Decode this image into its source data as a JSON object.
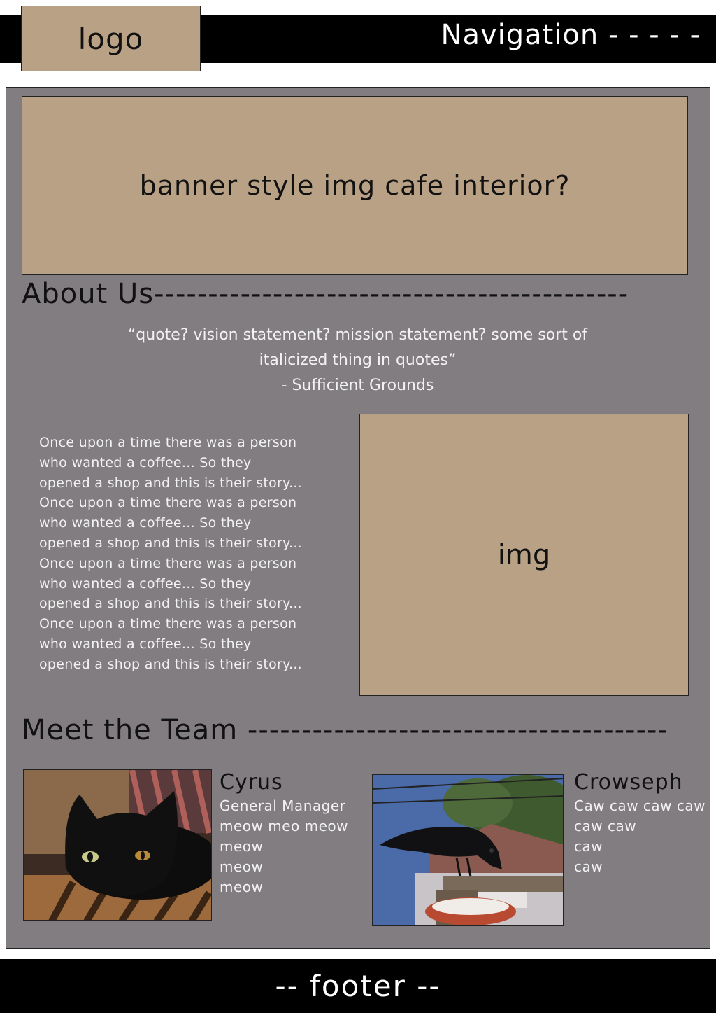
{
  "header": {
    "logo_label": "logo",
    "nav_label": "Navigation - - - - -"
  },
  "banner": {
    "label": "banner style img cafe interior?"
  },
  "about": {
    "title": "About Us--------------------------------------------",
    "quote_line1": "“quote? vision statement? mission statement? some sort of",
    "quote_line2": "italicized thing in quotes”",
    "quote_attribution": "- Sufficient Grounds",
    "story_lines": [
      "Once upon a time there was a person",
      "who wanted a coffee... So they",
      "opened a shop and this is their story...",
      "Once upon a time there was a person",
      "who wanted a coffee... So they",
      "opened a shop and this is their story...",
      "Once upon a time there was a person",
      "who wanted a coffee... So they",
      "opened a shop and this is their story...",
      "Once upon a time there was a person",
      "who wanted a coffee... So they",
      "opened a shop and this is their story..."
    ],
    "image_label": "img"
  },
  "team": {
    "title": "Meet the Team ---------------------------------------",
    "members": [
      {
        "name": "Cyrus",
        "lines": [
          "General Manager",
          "meow meo meow",
          "meow",
          "meow",
          "meow"
        ],
        "photo": "black-cat-photo"
      },
      {
        "name": "Crowseph",
        "lines": [
          "Caw caw caw caw",
          "caw caw",
          "caw",
          "caw"
        ],
        "photo": "crow-photo"
      }
    ]
  },
  "footer": {
    "label": "-- footer --"
  },
  "colors": {
    "placeholder_tan": "#b9a185",
    "content_gray": "#827d80",
    "bar_black": "#000000",
    "light_text": "#f2f2f2"
  }
}
